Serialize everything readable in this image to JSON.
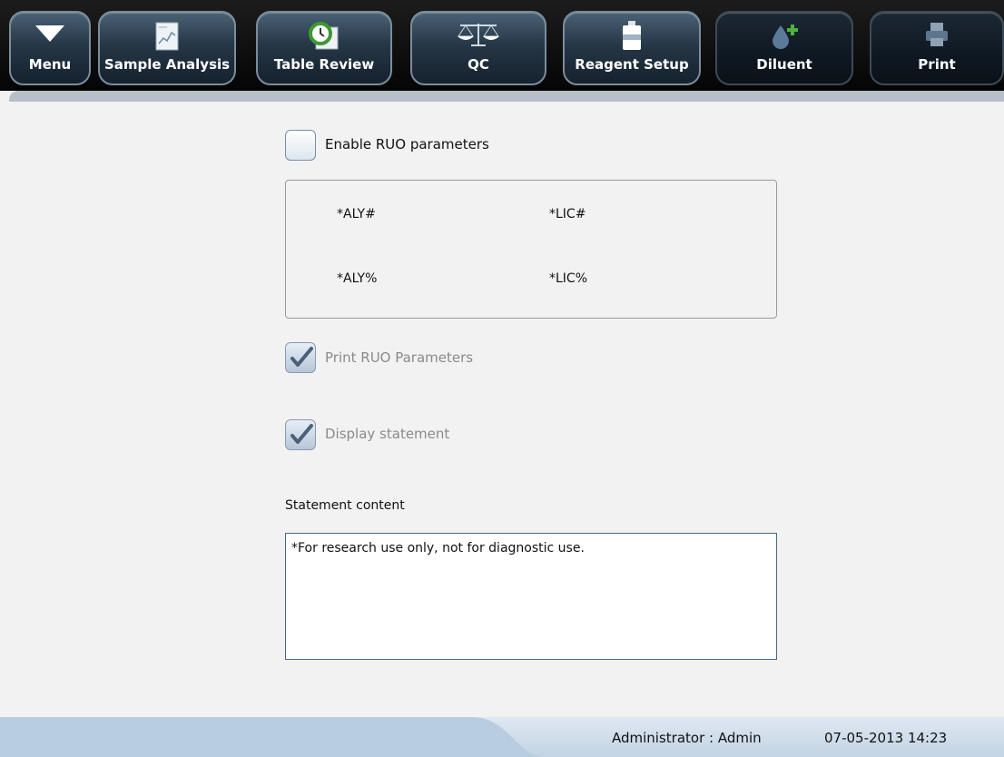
{
  "toolbar": {
    "menu": "Menu",
    "sample_analysis": "Sample Analysis",
    "table_review": "Table Review",
    "qc": "QC",
    "reagent_setup": "Reagent Setup",
    "diluent": "Diluent",
    "print": "Print"
  },
  "ruo": {
    "enable_label": "Enable RUO parameters",
    "enable_checked": false,
    "params": [
      "*ALY#",
      "*LIC#",
      "*ALY%",
      "*LIC%"
    ],
    "print_label": "Print RUO Parameters",
    "print_checked": true,
    "display_label": "Display statement",
    "display_checked": true
  },
  "statement": {
    "label": "Statement content",
    "value": "*For research use only, not for diagnostic use."
  },
  "status": {
    "user": "Administrator : Admin",
    "datetime": "07-05-2013 14:23"
  },
  "colors": {
    "toolbar_bg": "#0d0d0d",
    "button_active": "#263747",
    "content_bg": "#f2f2f2",
    "statusbar": "#c9d8e8"
  }
}
